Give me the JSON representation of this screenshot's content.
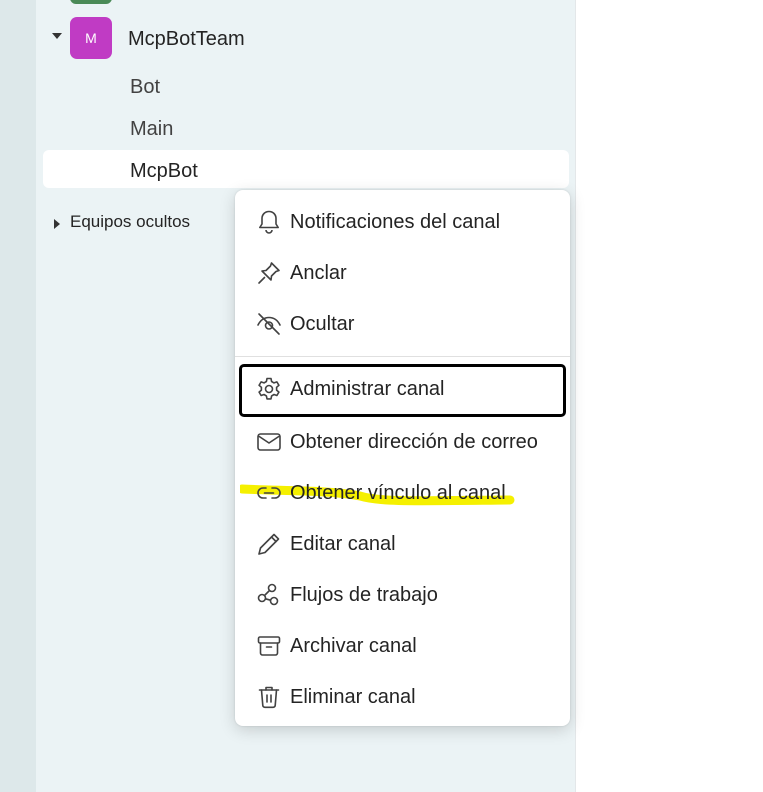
{
  "team": {
    "avatar_letter": "M",
    "avatar_color": "#c03bc4",
    "name": "McpBotTeam"
  },
  "channels": [
    {
      "label": "Bot"
    },
    {
      "label": "Main"
    },
    {
      "label": "McpBot"
    }
  ],
  "hidden_teams_label": "Equipos ocultos",
  "context_menu": {
    "items": [
      {
        "icon": "bell-icon",
        "label": "Notificaciones del canal"
      },
      {
        "icon": "pin-icon",
        "label": "Anclar"
      },
      {
        "icon": "eye-off-icon",
        "label": "Ocultar"
      },
      {
        "icon": "gear-icon",
        "label": "Administrar canal"
      },
      {
        "icon": "mail-icon",
        "label": "Obtener dirección de correo"
      },
      {
        "icon": "link-icon",
        "label": "Obtener vínculo al canal"
      },
      {
        "icon": "pencil-icon",
        "label": "Editar canal"
      },
      {
        "icon": "workflow-icon",
        "label": "Flujos de trabajo"
      },
      {
        "icon": "archive-icon",
        "label": "Archivar canal"
      },
      {
        "icon": "trash-icon",
        "label": "Eliminar canal"
      }
    ]
  },
  "colors": {
    "highlight": "#f5f000",
    "focus_border": "#000000"
  }
}
